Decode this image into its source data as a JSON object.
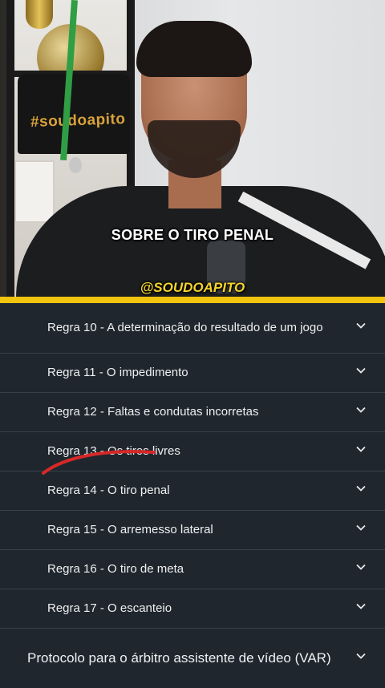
{
  "video": {
    "caption": "SOBRE O TIRO PENAL",
    "handle": "@SOUDOAPITO",
    "shirt_text": "#soudoapito"
  },
  "rules_list": [
    {
      "label": "Regra 10 - A determinação do resultado de um jogo"
    },
    {
      "label": "Regra 11 - O impedimento"
    },
    {
      "label": "Regra 12 - Faltas e condutas incorretas"
    },
    {
      "label": "Regra 13 - Os tiros livres"
    },
    {
      "label": "Regra 14 - O tiro penal"
    },
    {
      "label": "Regra 15 - O arremesso lateral"
    },
    {
      "label": "Regra 16 - O tiro de meta"
    },
    {
      "label": "Regra 17 - O escanteio"
    }
  ],
  "protocol": {
    "label": "Protocolo para o árbitro assistente de vídeo (VAR)"
  },
  "icons": {
    "row_expand": "chevron-down-icon"
  },
  "colors": {
    "accent": "#f1c40f",
    "background": "#1f262d",
    "annotation": "#d62828"
  }
}
